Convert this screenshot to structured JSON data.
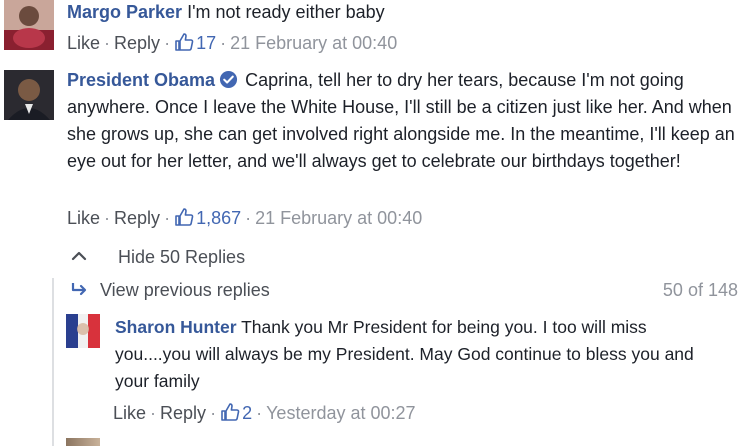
{
  "comments": [
    {
      "author": "Margo Parker",
      "text": "I'm not ready either baby",
      "actions": {
        "like_label": "Like",
        "reply_label": "Reply",
        "likes": "17",
        "timestamp": "21 February at 00:40"
      }
    },
    {
      "author": "President Obama",
      "verified": true,
      "text": "Caprina, tell her to dry her tears, because I'm not going anywhere. Once I leave the White House, I'll still be a citizen just like her. And when she grows up, she can get involved right alongside me. In the meantime, I'll keep an eye out for her letter, and we'll always get to celebrate our birthdays together!",
      "actions": {
        "like_label": "Like",
        "reply_label": "Reply",
        "likes": "1,867",
        "timestamp": "21 February at 00:40"
      }
    }
  ],
  "replies": {
    "toggle_label": "Hide 50 Replies",
    "view_previous_label": "View previous replies",
    "count_label": "50 of 148",
    "items": [
      {
        "author": "Sharon Hunter",
        "text": "Thank you Mr President for being you. I too will miss you....you will always be my President. May God continue to bless you and your family",
        "actions": {
          "like_label": "Like",
          "reply_label": "Reply",
          "likes": "2",
          "timestamp": "Yesterday at 00:27"
        }
      }
    ]
  },
  "icons": {
    "like": "thumbs-up-icon",
    "verified": "verified-badge-icon",
    "collapse": "chevron-up-icon",
    "view_previous": "reply-arrow-icon"
  },
  "colors": {
    "author_link": "#365899",
    "meta_text": "#90949c",
    "like_blue": "#4267b2",
    "verified_blue": "#4267b2"
  }
}
